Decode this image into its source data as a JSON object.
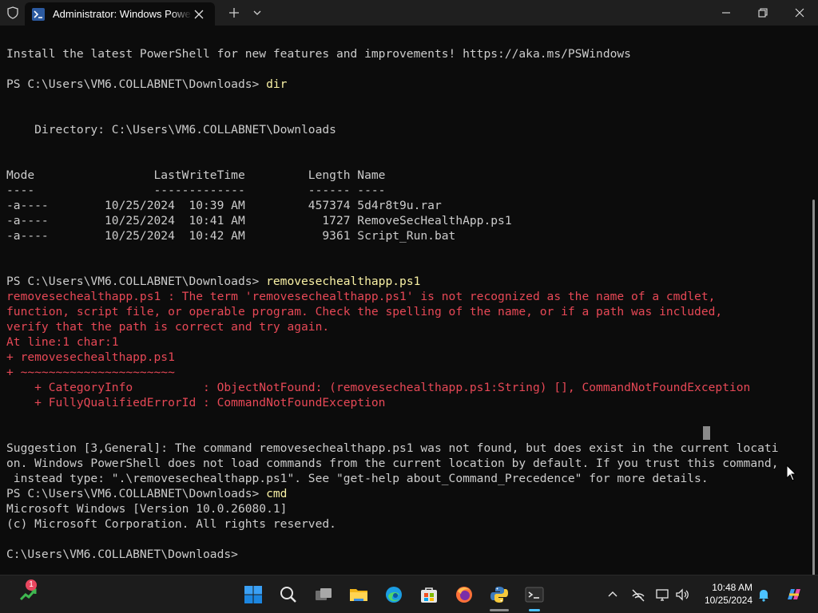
{
  "window": {
    "tab_title": "Administrator: Windows PowerShell"
  },
  "terminal": {
    "lines": [
      {
        "type": "text",
        "text": "Install the latest PowerShell for new features and improvements! https://aka.ms/PSWindows"
      },
      {
        "type": "blank",
        "text": ""
      },
      {
        "type": "prompt",
        "text": "PS C:\\Users\\VM6.COLLABNET\\Downloads> ",
        "command": "dir"
      },
      {
        "type": "blank",
        "text": ""
      },
      {
        "type": "blank",
        "text": ""
      },
      {
        "type": "text",
        "text": "    Directory: C:\\Users\\VM6.COLLABNET\\Downloads"
      },
      {
        "type": "blank",
        "text": ""
      },
      {
        "type": "blank",
        "text": ""
      },
      {
        "type": "text",
        "text": "Mode                 LastWriteTime         Length Name"
      },
      {
        "type": "text",
        "text": "----                 -------------         ------ ----"
      },
      {
        "type": "text",
        "text": "-a----        10/25/2024  10:39 AM         457374 5d4r8t9u.rar"
      },
      {
        "type": "text",
        "text": "-a----        10/25/2024  10:41 AM           1727 RemoveSecHealthApp.ps1"
      },
      {
        "type": "text",
        "text": "-a----        10/25/2024  10:42 AM           9361 Script_Run.bat"
      },
      {
        "type": "blank",
        "text": ""
      },
      {
        "type": "blank",
        "text": ""
      },
      {
        "type": "prompt",
        "text": "PS C:\\Users\\VM6.COLLABNET\\Downloads> ",
        "command": "removesechealthapp.ps1"
      },
      {
        "type": "error",
        "text": "removesechealthapp.ps1 : The term 'removesechealthapp.ps1' is not recognized as the name of a cmdlet,"
      },
      {
        "type": "error",
        "text": "function, script file, or operable program. Check the spelling of the name, or if a path was included,"
      },
      {
        "type": "error",
        "text": "verify that the path is correct and try again."
      },
      {
        "type": "error",
        "text": "At line:1 char:1"
      },
      {
        "type": "error",
        "text": "+ removesechealthapp.ps1"
      },
      {
        "type": "error",
        "text": "+ ~~~~~~~~~~~~~~~~~~~~~~"
      },
      {
        "type": "error",
        "text": "    + CategoryInfo          : ObjectNotFound: (removesechealthapp.ps1:String) [], CommandNotFoundException"
      },
      {
        "type": "error",
        "text": "    + FullyQualifiedErrorId : CommandNotFoundException"
      },
      {
        "type": "blank",
        "text": ""
      },
      {
        "type": "blank",
        "text": ""
      },
      {
        "type": "text",
        "text": "Suggestion [3,General]: The command removesechealthapp.ps1 was not found, but does exist in the current locati"
      },
      {
        "type": "text",
        "text": "on. Windows PowerShell does not load commands from the current location by default. If you trust this command,"
      },
      {
        "type": "text",
        "text": " instead type: \".\\removesechealthapp.ps1\". See \"get-help about_Command_Precedence\" for more details."
      },
      {
        "type": "prompt",
        "text": "PS C:\\Users\\VM6.COLLABNET\\Downloads> ",
        "command": "cmd"
      },
      {
        "type": "text",
        "text": "Microsoft Windows [Version 10.0.26080.1]"
      },
      {
        "type": "text",
        "text": "(c) Microsoft Corporation. All rights reserved."
      },
      {
        "type": "blank",
        "text": ""
      },
      {
        "type": "prompt",
        "text": "C:\\Users\\VM6.COLLABNET\\Downloads>",
        "command": ""
      }
    ]
  },
  "taskbar": {
    "widgets_badge": "1",
    "apps": [
      "start-icon",
      "search-icon",
      "task-view-icon",
      "file-explorer-icon",
      "edge-icon",
      "store-icon",
      "firefox-icon",
      "python-icon",
      "terminal-icon"
    ],
    "tray": [
      "chevron-up-icon",
      "network-off-icon",
      "display-icon",
      "volume-icon",
      "notification-bell-icon",
      "copilot-icon"
    ],
    "time": "10:48 AM",
    "date": "10/25/2024"
  },
  "colors": {
    "background": "#0c0c0c",
    "text": "#cccccc",
    "error": "#e74856",
    "command": "#f9f1a5",
    "accent": "#4cc2ff"
  }
}
